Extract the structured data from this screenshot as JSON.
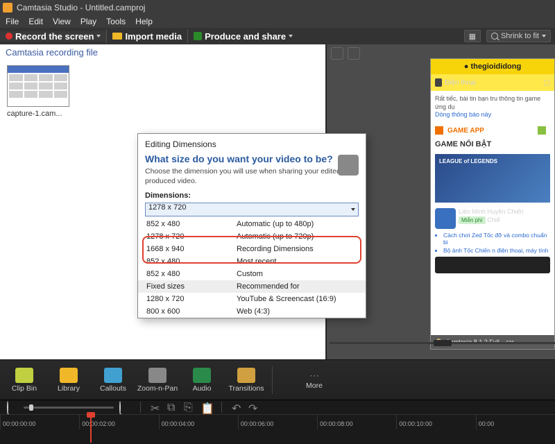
{
  "window": {
    "title": "Camtasia Studio - Untitled.camproj"
  },
  "menu": {
    "file": "File",
    "edit": "Edit",
    "view": "View",
    "play": "Play",
    "tools": "Tools",
    "help": "Help"
  },
  "toolbar": {
    "record": "Record the screen",
    "import": "Import media",
    "produce": "Produce and share",
    "shrink": "Shrink to fit"
  },
  "clipbin": {
    "header": "Camtasia recording file",
    "item0": "capture-1.cam..."
  },
  "dialog": {
    "title": "Editing Dimensions",
    "question": "What size do you want your video to be?",
    "subtitle": "Choose the dimension you will use when sharing your edited and produced video.",
    "dimLabel": "Dimensions:",
    "selected": "1278 x 720",
    "rows": [
      {
        "size": "852 x 480",
        "desc": "Automatic (up to 480p)"
      },
      {
        "size": "1278 x 720",
        "desc": "Automatic (up to 720p)"
      },
      {
        "size": "1668 x 940",
        "desc": "Recording Dimensions"
      },
      {
        "size": "852 x 480",
        "desc": "Most recent"
      },
      {
        "size": "852 x 480",
        "desc": "Custom"
      },
      {
        "size": "Fixed sizes",
        "desc": "Recommended for"
      },
      {
        "size": "1280 x 720",
        "desc": "YouTube & Screencast (16:9)"
      },
      {
        "size": "800 x 600",
        "desc": "Web (4:3)"
      }
    ]
  },
  "tabs": {
    "clipbin": "Clip Bin",
    "library": "Library",
    "callouts": "Callouts",
    "zoompan": "Zoom-n-Pan",
    "audio": "Audio",
    "transitions": "Transitions",
    "more": "More"
  },
  "timeline": {
    "ticks": [
      "00:00:00:00",
      "00:00:02:00",
      "00:00:04:00",
      "00:00:06:00",
      "00:00:08:00",
      "00:00:10:00",
      "00:00"
    ]
  },
  "preview": {
    "brand": "● thegioididong",
    "tab1": "Điện thoại",
    "text1": "Rất tiếc, bài tin bạn tru thông tin game ứng dụ",
    "link1": "Dòng thông báo này",
    "gameapp": "GAME APP",
    "section": "GAME NỔI BẬT",
    "card": "LEAGUE of LEGENDS",
    "li1": "Liên Minh Huyền Chiến",
    "mp": "Miễn phí",
    "chie": "Chiế",
    "b1": "Cách chơi Zed Tốc đỡ và combo chuẩn bi",
    "b2": "Bộ ảnh Tốc Chiến n điện thoại, máy tính",
    "foot": "Camtasia 8.1.2 Full....rar"
  }
}
